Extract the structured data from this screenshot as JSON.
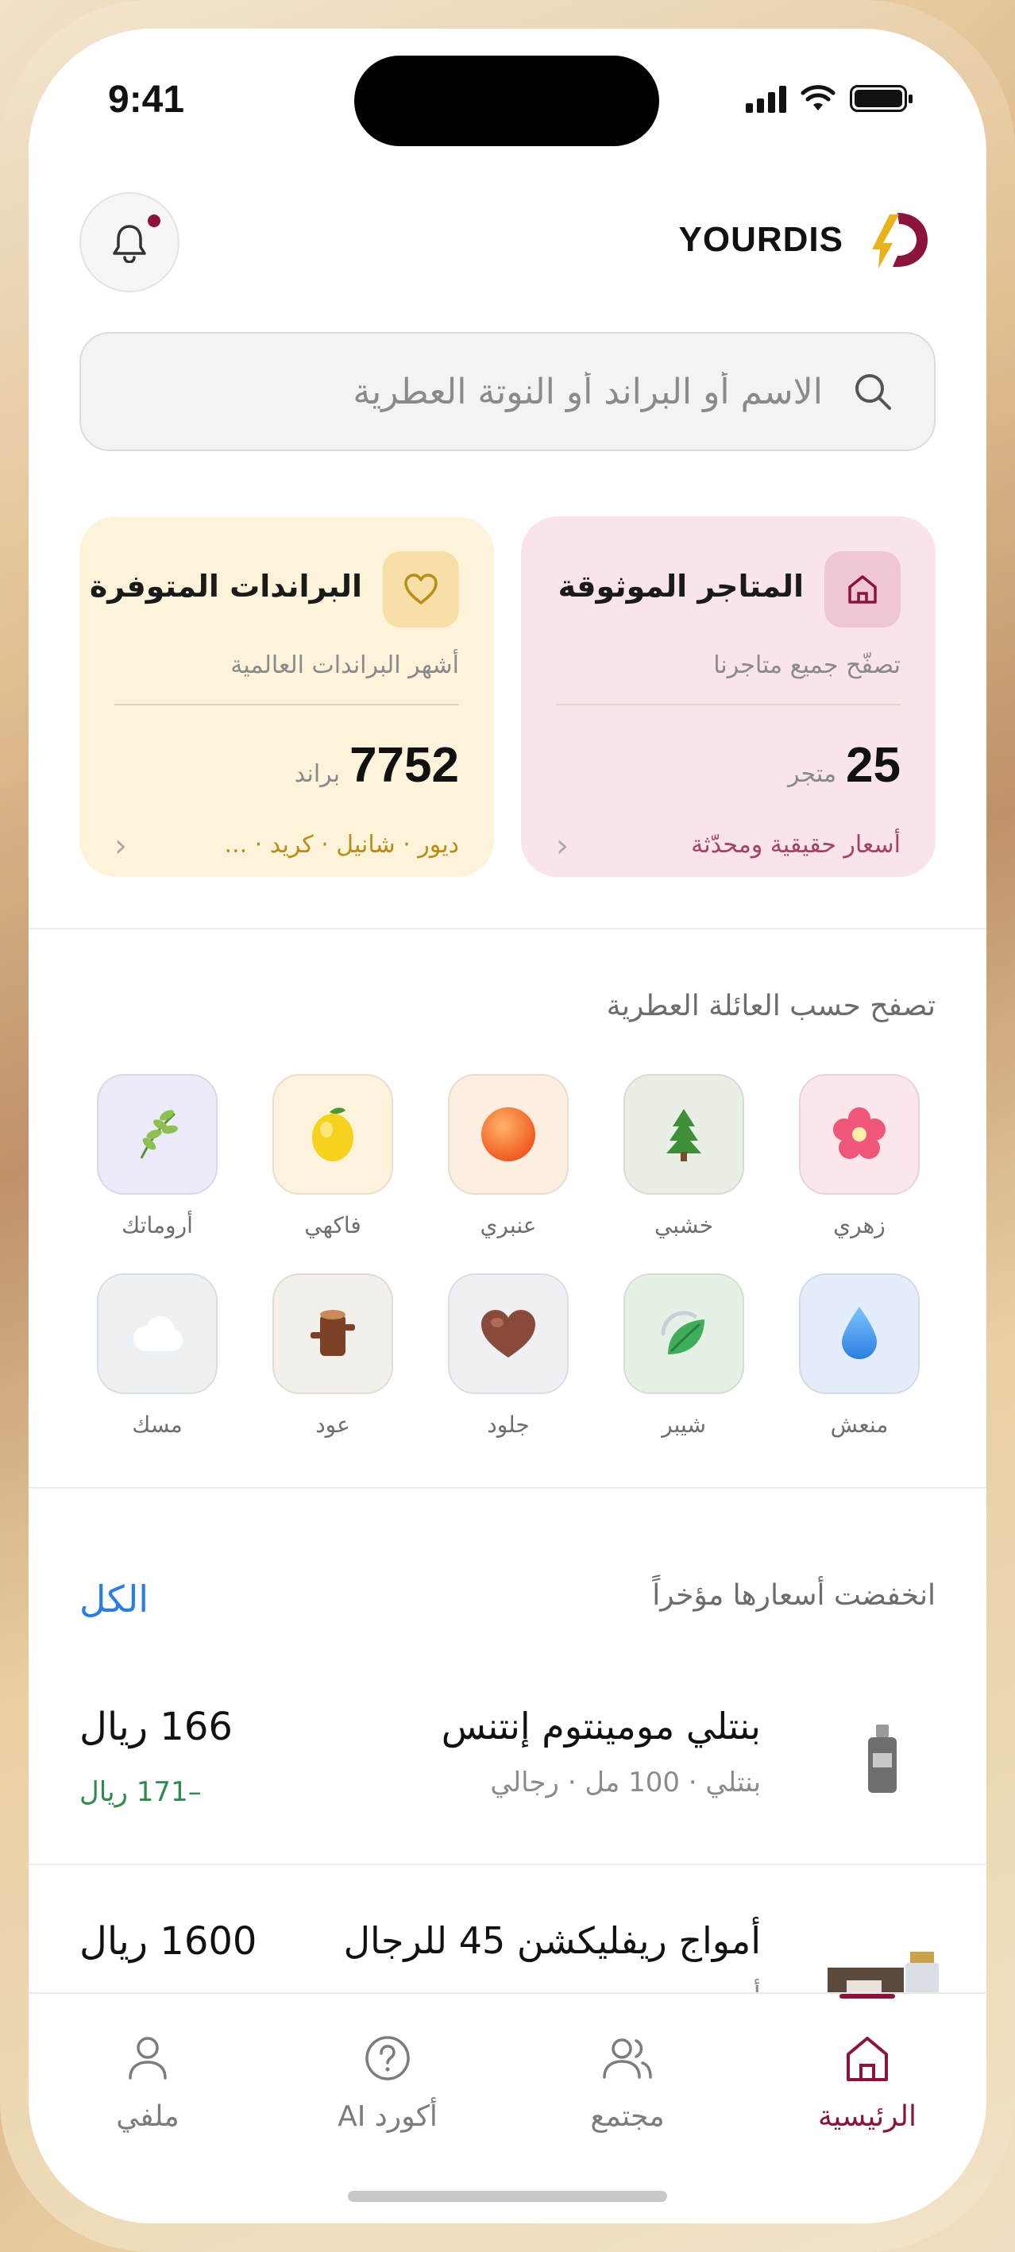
{
  "status_bar": {
    "time": "9:41"
  },
  "header": {
    "brand_name": "YOURDIS",
    "notification_has_unread": true
  },
  "search": {
    "placeholder": "الاسم أو البراند أو النوتة العطرية"
  },
  "cards": {
    "stores": {
      "title": "المتاجر الموثوقة",
      "subtitle": "تصفّح جميع متاجرنا",
      "count": "25",
      "unit": "متجر",
      "footer": "أسعار حقيقية ومحدّثة",
      "icon": "store-icon"
    },
    "brands": {
      "title": "البراندات المتوفرة",
      "subtitle": "أشهر البراندات العالمية",
      "count": "7752",
      "unit": "براند",
      "footer": "ديور · شانيل · كريد · ...",
      "icon": "heart-icon"
    }
  },
  "families": {
    "title": "تصفح حسب العائلة العطرية",
    "items": [
      {
        "label": "زهري",
        "icon": "flower-icon",
        "bg": "#fbe6ec"
      },
      {
        "label": "خشبي",
        "icon": "tree-icon",
        "bg": "#e9efe4"
      },
      {
        "label": "عنبري",
        "icon": "amber-ball-icon",
        "bg": "#fcefe2"
      },
      {
        "label": "فاكهي",
        "icon": "lemon-icon",
        "bg": "#fdf3dc"
      },
      {
        "label": "أروماتك",
        "icon": "herb-icon",
        "bg": "#ecebfa"
      },
      {
        "label": "منعش",
        "icon": "water-drop-icon",
        "bg": "#e3eefa"
      },
      {
        "label": "شيبر",
        "icon": "leaf-icon",
        "bg": "#e6f1e6"
      },
      {
        "label": "جلود",
        "icon": "leather-heart-icon",
        "bg": "#eef0f3"
      },
      {
        "label": "عود",
        "icon": "wood-log-icon",
        "bg": "#f3efea"
      },
      {
        "label": "مسك",
        "icon": "cloud-icon",
        "bg": "#eef1f4"
      }
    ]
  },
  "price_drops": {
    "title": "انخفضت أسعارها مؤخراً",
    "see_all": "الكل",
    "items": [
      {
        "name": "بنتلي مومينتوم إنتنس",
        "meta": "بنتلي · 100 مل · رجالي",
        "price": "166 ريال",
        "old_price": "–171 ريال"
      },
      {
        "name": "أمواج ريفليكشن 45 للرجال",
        "meta": "أ",
        "price": "1600 ريال",
        "old_price": ""
      }
    ]
  },
  "tabbar": {
    "items": [
      {
        "label": "الرئيسية",
        "icon": "home-icon",
        "active": true
      },
      {
        "label": "مجتمع",
        "icon": "users-icon",
        "active": false
      },
      {
        "label": "أكورد AI",
        "icon": "help-circle-icon",
        "active": false
      },
      {
        "label": "ملفي",
        "icon": "user-icon",
        "active": false
      }
    ]
  },
  "colors": {
    "accent": "#8b1538",
    "link": "#2a7de1",
    "price_drop": "#2f8a4e",
    "brand_gold": "#e9b21b"
  }
}
